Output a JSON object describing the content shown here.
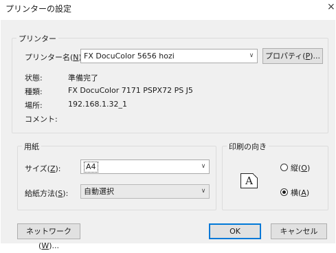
{
  "window": {
    "title": "プリンターの設定",
    "close_symbol": "×"
  },
  "printer": {
    "group_label": "プリンター",
    "name_label": "プリンター名(",
    "name_label_mnemonic": "N",
    "name_label_end": "):",
    "name_value": "FX DocuColor 5656 hozi",
    "properties_label": "プロパティ(",
    "properties_mnemonic": "P",
    "properties_end": ")...",
    "status_label": "状態:",
    "status_value": "準備完了",
    "type_label": "種類:",
    "type_value": "FX DocuColor 7171 PSPX72 PS J5",
    "location_label": "場所:",
    "location_value": "192.168.1.32_1",
    "comment_label": "コメント:",
    "comment_value": ""
  },
  "paper": {
    "group_label": "用紙",
    "size_label": "サイズ(",
    "size_mnemonic": "Z",
    "size_end": "):",
    "size_value": "A4",
    "source_label": "給紙方法(",
    "source_mnemonic": "S",
    "source_end": "):",
    "source_value": "自動選択"
  },
  "orientation": {
    "group_label": "印刷の向き",
    "icon_letter": "A",
    "portrait_label": "縦(",
    "portrait_mnemonic": "O",
    "portrait_end": ")",
    "landscape_label": "横(",
    "landscape_mnemonic": "A",
    "landscape_end": ")",
    "selected": "landscape"
  },
  "buttons": {
    "network_label": "ネットワーク(",
    "network_mnemonic": "W",
    "network_end": ")...",
    "ok_label": "OK",
    "cancel_label": "キャンセル"
  },
  "icons": {
    "dropdown": "chevron-down-icon",
    "close": "close-icon"
  },
  "colors": {
    "accent": "#0078d7",
    "dialog_bg": "#f0f0f0"
  }
}
